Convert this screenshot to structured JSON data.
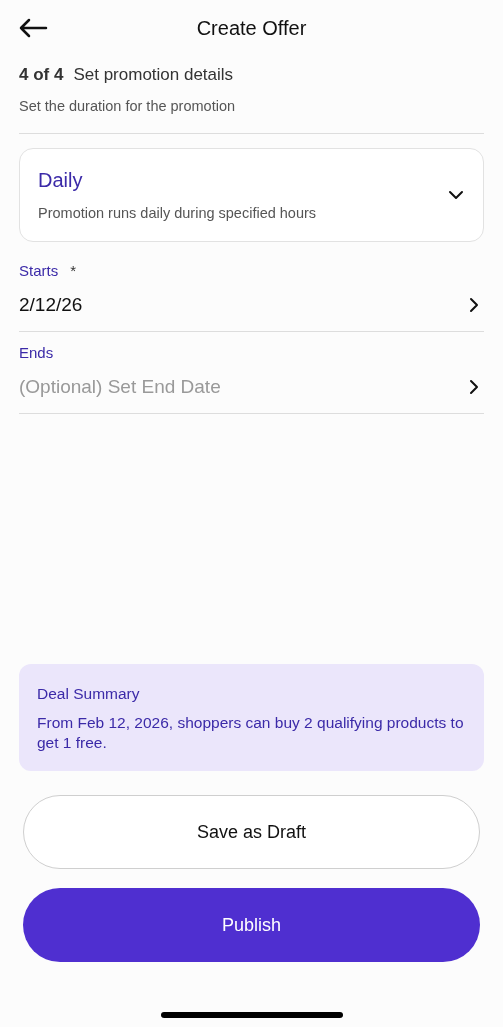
{
  "header": {
    "title": "Create Offer"
  },
  "step": {
    "counter": "4 of 4",
    "title": "Set promotion details",
    "subtitle": "Set the duration for the promotion"
  },
  "frequency": {
    "value": "Daily",
    "description": "Promotion runs daily during specified hours",
    "expanded": false
  },
  "fields": [
    {
      "label": "Starts",
      "required_mark": "*",
      "value": "2/12/26"
    },
    {
      "label": "Ends",
      "placeholder": "(Optional) Set End Date"
    }
  ],
  "summary": {
    "title": "Deal Summary",
    "text": "From Feb 12, 2026, shoppers can buy 2 qualifying products to get 1 free."
  },
  "buttons": [
    {
      "label": "Save as Draft",
      "kind": "secondary"
    },
    {
      "label": "Publish",
      "kind": "primary"
    }
  ]
}
